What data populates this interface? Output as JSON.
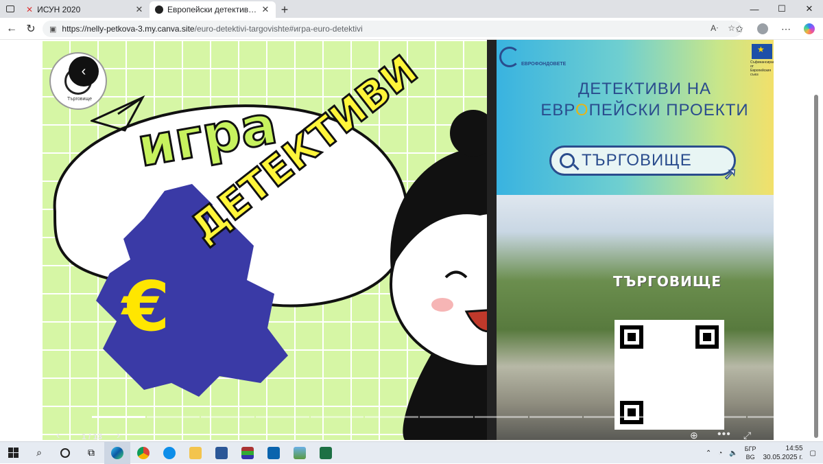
{
  "browser": {
    "tabs": [
      {
        "title": "ИСУН 2020",
        "active": false
      },
      {
        "title": "Европейски детективи - Търговище",
        "active": true
      }
    ],
    "new_tab": "+",
    "url": {
      "host": "https://nelly-petkova-3.my.canva.site",
      "path": "/euro-detektivi-targovishte#игра-euro-detektivi"
    },
    "controls": {
      "minimize": "—",
      "maximize": "☐",
      "close": "✕"
    }
  },
  "slide": {
    "title_line1": "игра",
    "title_line2": "ДЕТЕКТИВИ",
    "badge_caption": "Търговище",
    "banner_title_part1": "ДЕТЕКТИВИ НА",
    "banner_title_part2a": "ЕВР",
    "banner_title_part2b": "О",
    "banner_title_part2c": "ПЕЙСКИ ПР",
    "banner_title_part2d": "О",
    "banner_title_part2e": "ЕКТИ",
    "search_text": "ТЪРГОВИЩЕ",
    "logo_text": "ЕВРОФОНДОВЕТЕ",
    "eu_caption": "Съфинансирано от Европейския съюз",
    "town_sign": "ТЪРГОВИЩЕ",
    "page_counter": "1 / 13",
    "current_page": 1,
    "total_pages": 13
  },
  "taskbar": {
    "language": "БГР",
    "language_sub": "BG",
    "time": "14:55",
    "date": "30.05.2025 г."
  },
  "colors": {
    "grid_bg": "#d6f6a5",
    "title_green": "#c7f25e",
    "title_yellow": "#fff53a",
    "banner_blue": "#2a4c8d"
  }
}
